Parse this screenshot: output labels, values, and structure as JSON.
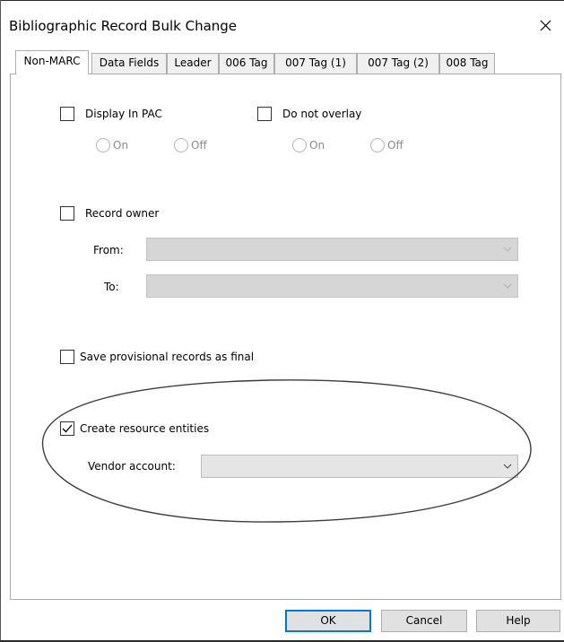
{
  "window": {
    "title": "Bibliographic Record Bulk Change"
  },
  "tabs": [
    {
      "label": "Non-MARC",
      "active": true
    },
    {
      "label": "Data Fields"
    },
    {
      "label": "Leader"
    },
    {
      "label": "006 Tag"
    },
    {
      "label": "007 Tag (1)"
    },
    {
      "label": "007 Tag (2)"
    },
    {
      "label": "008 Tag"
    }
  ],
  "display_in_pac": {
    "label": "Display In PAC",
    "checked": false,
    "on_label": "On",
    "off_label": "Off"
  },
  "do_not_overlay": {
    "label": "Do not overlay",
    "checked": false,
    "on_label": "On",
    "off_label": "Off"
  },
  "record_owner": {
    "label": "Record owner",
    "checked": false,
    "from_label": "From:",
    "to_label": "To:",
    "from_value": "",
    "to_value": ""
  },
  "save_provisional": {
    "label": "Save provisional records as final",
    "checked": false
  },
  "create_resource": {
    "label": "Create resource entities",
    "checked": true,
    "vendor_label": "Vendor account:",
    "vendor_value": ""
  },
  "buttons": {
    "ok": "OK",
    "cancel": "Cancel",
    "help": "Help"
  }
}
